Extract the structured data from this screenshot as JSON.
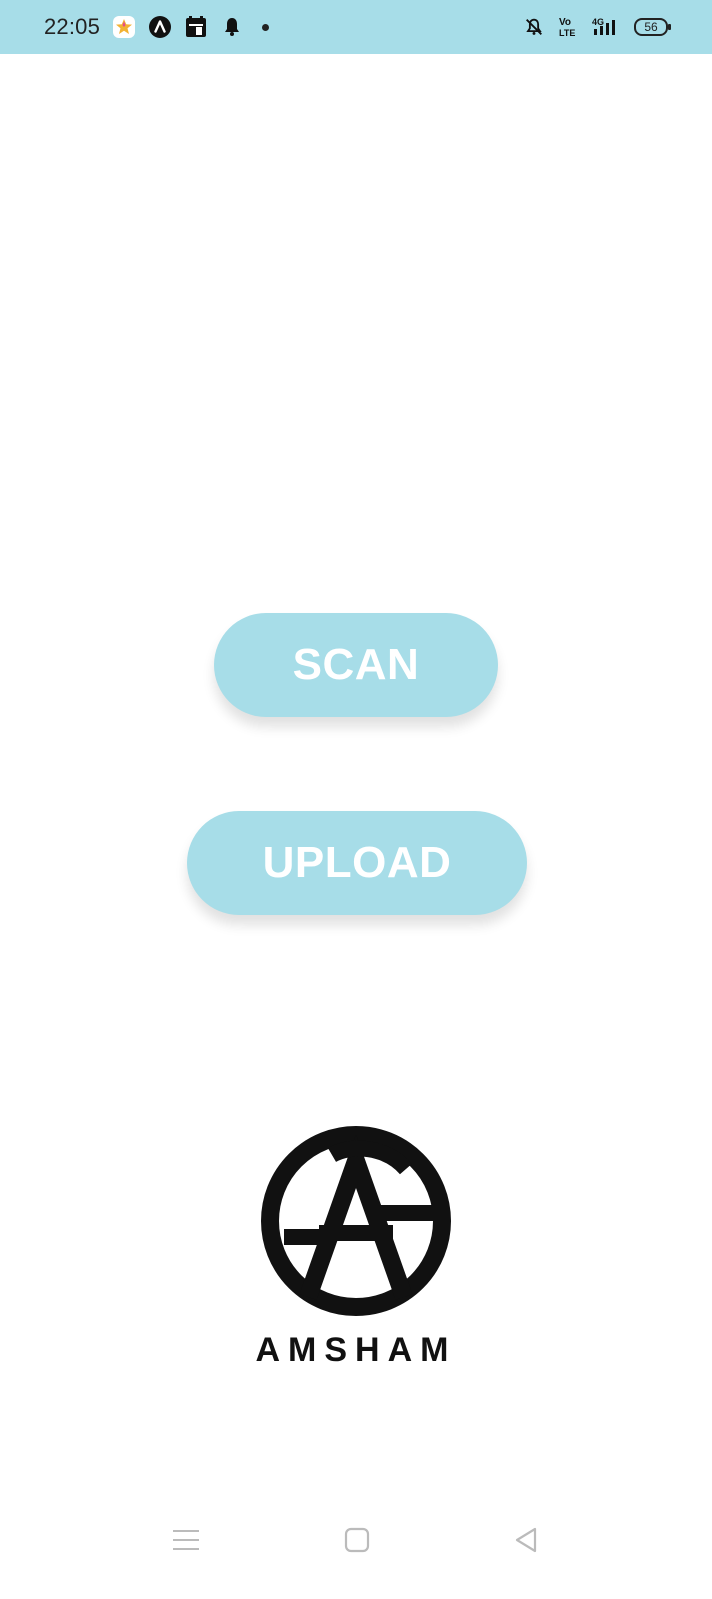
{
  "status_bar": {
    "time": "22:05",
    "battery": "56",
    "icons": [
      "photos-icon",
      "app-a-icon",
      "calendar-icon",
      "notification-bell-icon",
      "dot-icon",
      "mute-icon",
      "volte-icon",
      "signal-4g-icon",
      "battery-icon"
    ]
  },
  "main": {
    "scan_label": "SCAN",
    "upload_label": "UPLOAD"
  },
  "brand": {
    "name": "AMSHAM"
  },
  "nav": {
    "icons": [
      "menu-lines-icon",
      "home-square-icon",
      "back-triangle-icon"
    ]
  },
  "colors": {
    "accent": "#a7dde8",
    "button_text": "#ffffff",
    "logo": "#111111"
  }
}
